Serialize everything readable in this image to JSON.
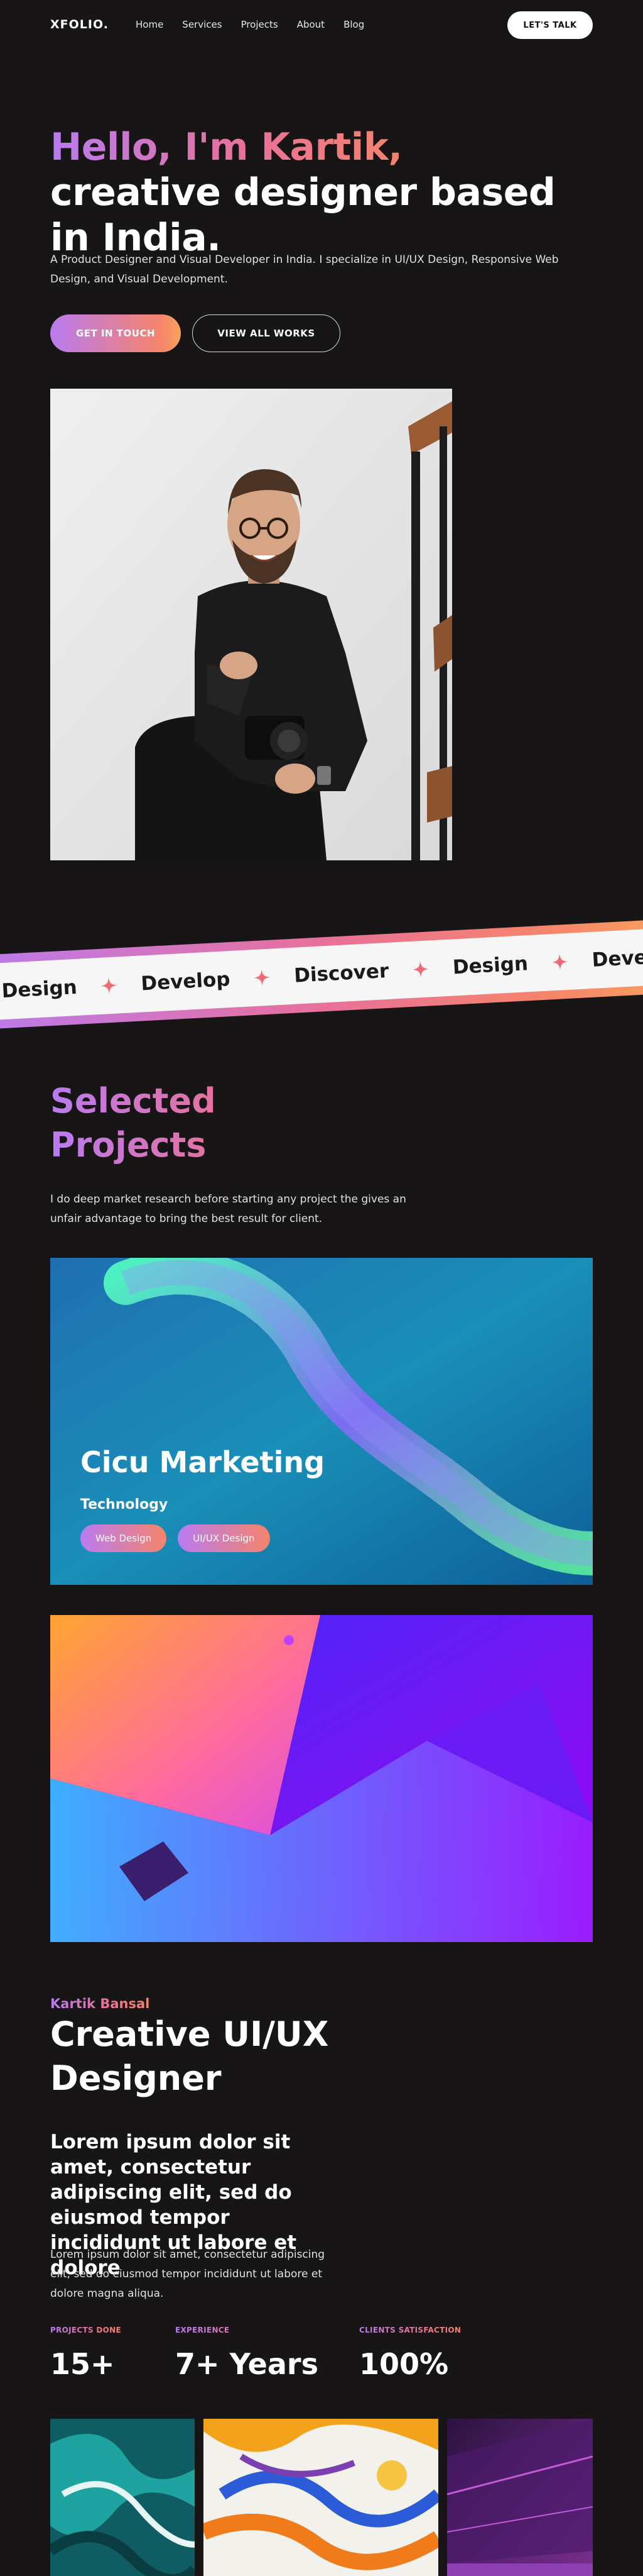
{
  "nav": {
    "logo": "XFOLIO.",
    "links": [
      "Home",
      "Services",
      "Projects",
      "About",
      "Blog"
    ],
    "cta": "LET'S TALK"
  },
  "hero": {
    "title_greeting": "Hello, I'm Kartik,",
    "title_rest": " creative designer based in India.",
    "description": "A Product Designer and Visual Developer in India. I specialize in UI/UX Design, Responsive Web Design, and Visual Development.",
    "primary_button": "GET IN TOUCH",
    "secondary_button": "VIEW ALL WORKS"
  },
  "marquee": {
    "words": [
      "Design",
      "Develop",
      "Discover",
      "Design",
      "Develop"
    ]
  },
  "projects": {
    "title_line1": "Selected",
    "title_line2": "Projects",
    "description": "I do deep market research before starting any project the gives an unfair advantage to bring the best result for client.",
    "items": [
      {
        "title": "Cicu Marketing",
        "category": "Technology",
        "tags": [
          "Web Design",
          "UI/UX Design"
        ]
      }
    ]
  },
  "about": {
    "name": "Kartik Bansal",
    "title": "Creative UI/UX Designer",
    "lead": "Lorem ipsum dolor sit amet, consectetur adipiscing elit, sed do eiusmod tempor incididunt ut labore et dolore",
    "text": "Lorem ipsum dolor sit amet, consectetur adipiscing elit, sed do eiusmod tempor incididunt ut labore et dolore magna aliqua.",
    "stats": [
      {
        "label": "PROJECTS DONE",
        "value": "15+"
      },
      {
        "label": "EXPERIENCE",
        "value": "7+ Years"
      },
      {
        "label": "CLIENTS SATISFACTION",
        "value": "100%"
      }
    ]
  },
  "colors": {
    "background": "#171515",
    "accent_purple": "#b97bf0",
    "accent_pink": "#e8719a",
    "accent_orange": "#f5846b"
  }
}
